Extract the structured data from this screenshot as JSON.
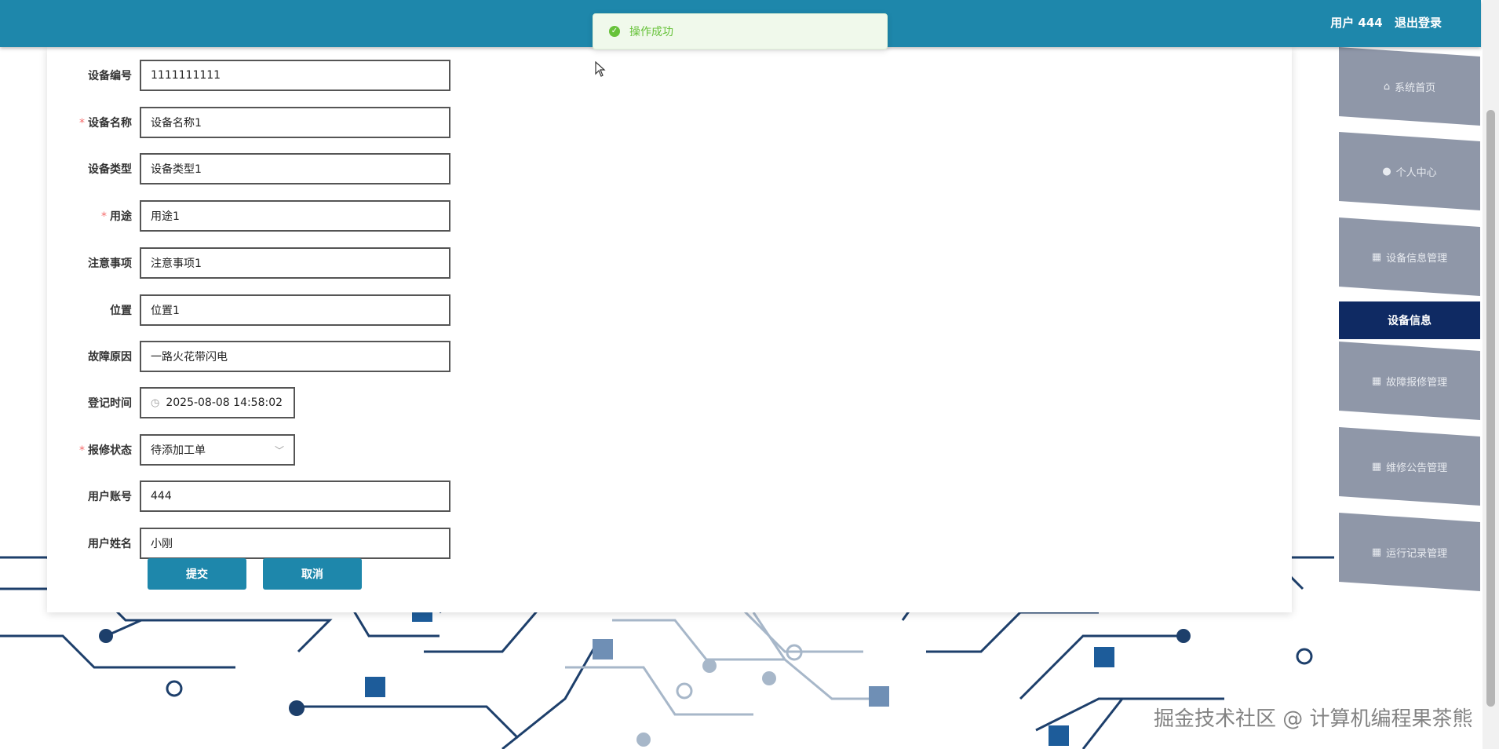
{
  "header": {
    "user_label": "用户 444",
    "logout_label": "退出登录"
  },
  "toast": {
    "message": "操作成功"
  },
  "form": {
    "fields": [
      {
        "label": "设备编号",
        "value": "1111111111",
        "required": false
      },
      {
        "label": "设备名称",
        "value": "设备名称1",
        "required": true
      },
      {
        "label": "设备类型",
        "value": "设备类型1",
        "required": false
      },
      {
        "label": "用途",
        "value": "用途1",
        "required": true
      },
      {
        "label": "注意事项",
        "value": "注意事项1",
        "required": false
      },
      {
        "label": "位置",
        "value": "位置1",
        "required": false
      },
      {
        "label": "故障原因",
        "value": "一路火花带闪电",
        "required": false
      },
      {
        "label": "登记时间",
        "value": "2025-08-08 14:58:02",
        "required": false
      },
      {
        "label": "报修状态",
        "value": "待添加工单",
        "required": true
      },
      {
        "label": "用户账号",
        "value": "444",
        "required": false
      },
      {
        "label": "用户姓名",
        "value": "小刚",
        "required": false
      }
    ],
    "submit_label": "提交",
    "cancel_label": "取消"
  },
  "sidebar": {
    "items": [
      {
        "label": "系统首页",
        "icon": "home-icon"
      },
      {
        "label": "个人中心",
        "icon": "user-icon"
      },
      {
        "label": "设备信息管理",
        "icon": "grid-icon"
      },
      {
        "label": "设备信息",
        "icon": "",
        "active": true
      },
      {
        "label": "故障报修管理",
        "icon": "grid-icon"
      },
      {
        "label": "维修公告管理",
        "icon": "grid-icon"
      },
      {
        "label": "运行记录管理",
        "icon": "grid-icon"
      }
    ]
  },
  "watermark": "掘金技术社区 @ 计算机编程果茶熊",
  "colors": {
    "header": "#1e87ab",
    "button": "#1e87ab",
    "nav_active": "#0f2a63",
    "nav_item": "#8f97a8",
    "success": "#67c23a"
  }
}
